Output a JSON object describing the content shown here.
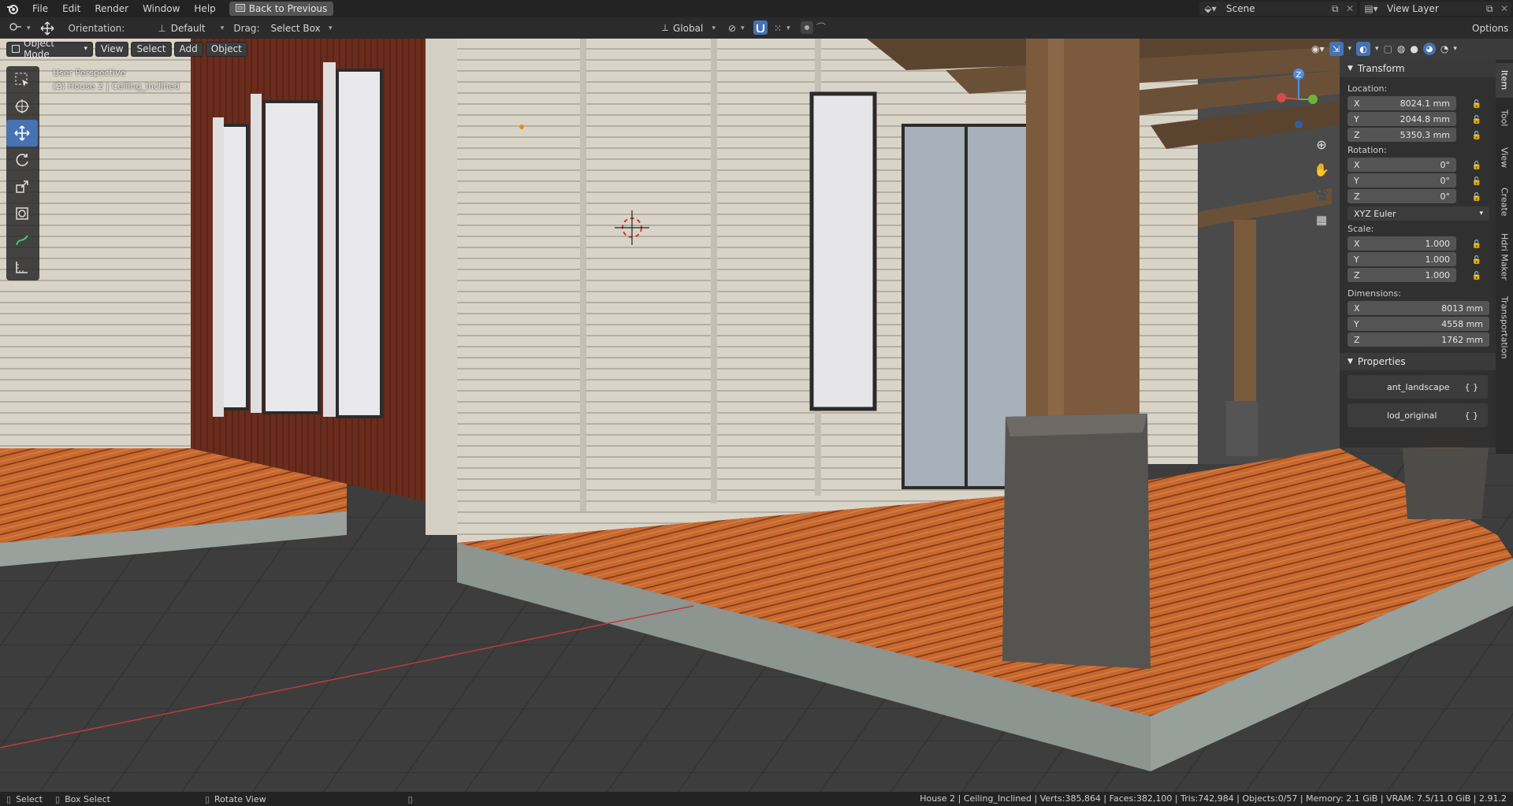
{
  "topbar": {
    "menus": [
      "File",
      "Edit",
      "Render",
      "Window",
      "Help"
    ],
    "back_button": "Back to Previous",
    "scene_name": "Scene",
    "view_layer": "View Layer"
  },
  "header": {
    "orientation_label": "Orientation:",
    "orientation_value": "Default",
    "drag_label": "Drag:",
    "drag_value": "Select Box",
    "transform_orientation": "Global",
    "options": "Options"
  },
  "viewport_header": {
    "mode": "Object Mode",
    "menus": [
      "View",
      "Select",
      "Add",
      "Object"
    ]
  },
  "viewport": {
    "perspective": "User Perspective",
    "context": "(2) House 2 | Ceiling_Inclined"
  },
  "gizmo": {
    "axes": {
      "x": "X",
      "y": "Y",
      "z": "Z"
    }
  },
  "npanel": {
    "transform_title": "Transform",
    "location_label": "Location:",
    "location": [
      {
        "axis": "X",
        "value": "8024.1 mm"
      },
      {
        "axis": "Y",
        "value": "2044.8 mm"
      },
      {
        "axis": "Z",
        "value": "5350.3 mm"
      }
    ],
    "rotation_label": "Rotation:",
    "rotation": [
      {
        "axis": "X",
        "value": "0°"
      },
      {
        "axis": "Y",
        "value": "0°"
      },
      {
        "axis": "Z",
        "value": "0°"
      }
    ],
    "rotation_mode": "XYZ Euler",
    "scale_label": "Scale:",
    "scale": [
      {
        "axis": "X",
        "value": "1.000"
      },
      {
        "axis": "Y",
        "value": "1.000"
      },
      {
        "axis": "Z",
        "value": "1.000"
      }
    ],
    "dimensions_label": "Dimensions:",
    "dimensions": [
      {
        "axis": "X",
        "value": "8013 mm"
      },
      {
        "axis": "Y",
        "value": "4558 mm"
      },
      {
        "axis": "Z",
        "value": "1762 mm"
      }
    ],
    "properties_title": "Properties",
    "properties": [
      {
        "name": "ant_landscape",
        "value": "{ }"
      },
      {
        "name": "lod_original",
        "value": "{ }"
      }
    ]
  },
  "side_tabs": [
    "Item",
    "Tool",
    "View",
    "Create",
    "Hdri Maker",
    "Transportation"
  ],
  "statusbar": {
    "select": "Select",
    "box_select": "Box Select",
    "rotate_view": "Rotate View",
    "stats": "House 2 | Ceiling_Inclined | Verts:385,864 | Faces:382,100 | Tris:742,984 | Objects:0/57 | Memory: 2.1 GiB | VRAM: 7.5/11.0 GiB | 2.91.2"
  },
  "colors": {
    "accent": "#4772b3",
    "deck_wood": "#c8672e",
    "siding": "#d8d3c7",
    "ground": "#3b3b3b",
    "red_axis": "#c0393b"
  }
}
